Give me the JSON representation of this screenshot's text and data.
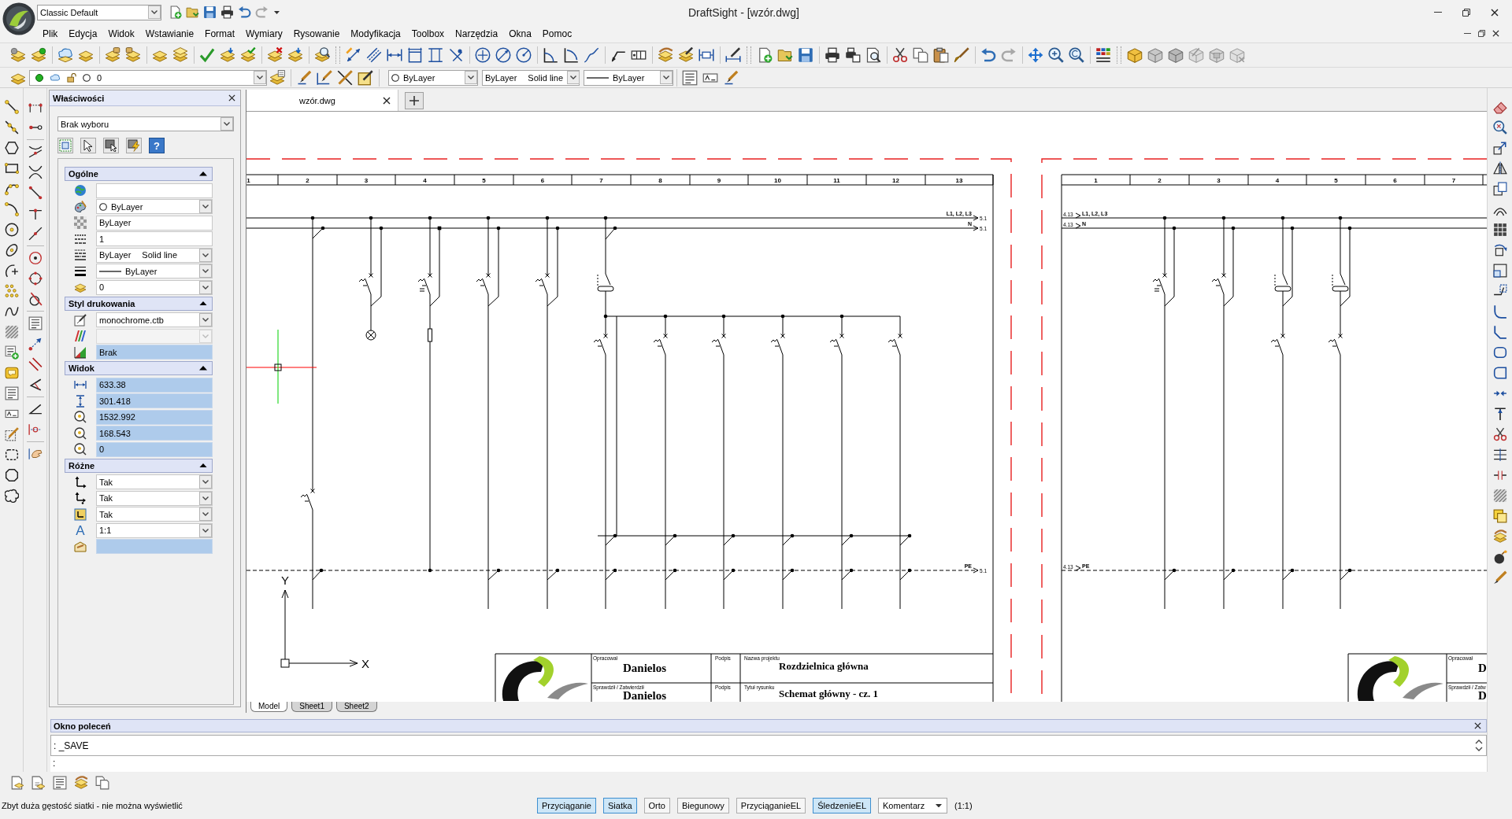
{
  "window": {
    "title": "DraftSight - [wzór.dwg]",
    "workspace": "Classic Default"
  },
  "menu": [
    "Plik",
    "Edycja",
    "Widok",
    "Wstawianie",
    "Format",
    "Wymiary",
    "Rysowanie",
    "Modyfikacja",
    "Toolbox",
    "Narzędzia",
    "Okna",
    "Pomoc"
  ],
  "layer_toolbar": {
    "layer": "0"
  },
  "property_toolbar": {
    "dropdowns": [
      {
        "kind": "color",
        "value": "ByLayer"
      },
      {
        "kind": "linetype",
        "value": "ByLayer",
        "description": "Solid line"
      },
      {
        "kind": "lineweight",
        "value": "ByLayer"
      }
    ]
  },
  "properties_panel": {
    "title": "Właściwości",
    "selection": "Brak wyboru",
    "help_glyph": "?",
    "sections": [
      {
        "title": "Ogólne",
        "expanded": true,
        "rows": [
          {
            "kind": "field"
          },
          {
            "kind": "colorpick",
            "value": "ByLayer"
          },
          {
            "kind": "field",
            "value": "ByLayer"
          },
          {
            "kind": "field",
            "value": "1"
          },
          {
            "kind": "select",
            "value": "ByLayer",
            "description": "Solid line"
          },
          {
            "kind": "linepick",
            "value": "ByLayer"
          },
          {
            "kind": "select",
            "value": "0"
          }
        ]
      },
      {
        "title": "Styl drukowania",
        "expanded": true,
        "rows": [
          {
            "kind": "select",
            "value": "monochrome.ctb"
          },
          {
            "kind": "greyed"
          },
          {
            "kind": "readonly",
            "value": "Brak"
          }
        ]
      },
      {
        "title": "Widok",
        "expanded": true,
        "rows": [
          {
            "kind": "readonly",
            "value": "633.38"
          },
          {
            "kind": "readonly",
            "value": "301.418"
          },
          {
            "kind": "readonly",
            "value": "1532.992"
          },
          {
            "kind": "readonly",
            "value": "168.543"
          },
          {
            "kind": "readonly",
            "value": "0"
          }
        ]
      },
      {
        "title": "Różne",
        "expanded": true,
        "rows": [
          {
            "kind": "select",
            "value": "Tak"
          },
          {
            "kind": "select",
            "value": "Tak"
          },
          {
            "kind": "select",
            "value": "Tak"
          },
          {
            "kind": "select",
            "value": "1:1",
            "glyph": "A"
          },
          {
            "kind": "readonly"
          }
        ]
      }
    ]
  },
  "document_tabs": [
    {
      "label": "wzór.dwg",
      "selected": true
    }
  ],
  "drawing": {
    "sheets": [
      {
        "kind": "left",
        "columns": [
          "1",
          "2",
          "3",
          "4",
          "5",
          "6",
          "7",
          "8",
          "9",
          "10",
          "11",
          "12",
          "13"
        ],
        "buses": [
          {
            "kind": "phases",
            "label": "L1, L2, L3",
            "reference": "5.1"
          },
          {
            "kind": "neutral",
            "label": "N",
            "reference": "5.1"
          },
          {
            "kind": "earth",
            "label": "PE",
            "reference": "5.1"
          }
        ],
        "title_block": {
          "rows": [
            [
              {
                "kind": "person",
                "caption": "Opracował",
                "value": "Danielos"
              },
              {
                "kind": "signature",
                "caption": "Podpis"
              },
              {
                "kind": "field",
                "caption": "Nazwa projektu",
                "value": "Rozdzielnica główna"
              }
            ],
            [
              {
                "kind": "person",
                "caption": "Sprawdził / Zatwierdził",
                "value": "Danielos"
              },
              {
                "kind": "signature",
                "caption": "Podpis"
              },
              {
                "kind": "field",
                "caption": "Tytuł rysunku",
                "value": "Schemat główny - cz. 1"
              }
            ]
          ]
        }
      },
      {
        "kind": "right",
        "columns": [
          "1",
          "2",
          "3",
          "4",
          "5",
          "6",
          "7"
        ],
        "buses": [
          {
            "kind": "phases",
            "label": "L1, L2, L3",
            "reference": "4.13"
          },
          {
            "kind": "neutral",
            "label": "N",
            "reference": "4.13"
          },
          {
            "kind": "earth",
            "label": "PE",
            "reference": "4.13"
          }
        ],
        "title_block": {
          "rows": [
            [
              {
                "kind": "person",
                "caption": "Opracował",
                "value": "D"
              }
            ],
            [
              {
                "kind": "person",
                "caption": "Sprawdził / Zatw",
                "value": "D"
              }
            ]
          ]
        }
      }
    ],
    "ucs": {
      "x_label": "X",
      "y_label": "Y"
    }
  },
  "layout_tabs": [
    {
      "label": "Model",
      "selected": true
    },
    {
      "label": "Sheet1",
      "selected": false
    },
    {
      "label": "Sheet2",
      "selected": false
    }
  ],
  "command_window": {
    "title": "Okno poleceń",
    "history": ": _SAVE",
    "prompt": ":"
  },
  "status_bar": {
    "message": "Zbyt duża gęstość siatki - nie można wyświetlić",
    "toggles": [
      {
        "label": "Przyciąganie",
        "on": true
      },
      {
        "label": "Siatka",
        "on": true
      },
      {
        "label": "Orto",
        "on": false
      },
      {
        "label": "Biegunowy",
        "on": false
      },
      {
        "label": "PrzyciąganieEL",
        "on": false
      },
      {
        "label": "ŚledzenieEL",
        "on": true
      }
    ],
    "annotation": "Komentarz",
    "scale": "(1:1)"
  }
}
